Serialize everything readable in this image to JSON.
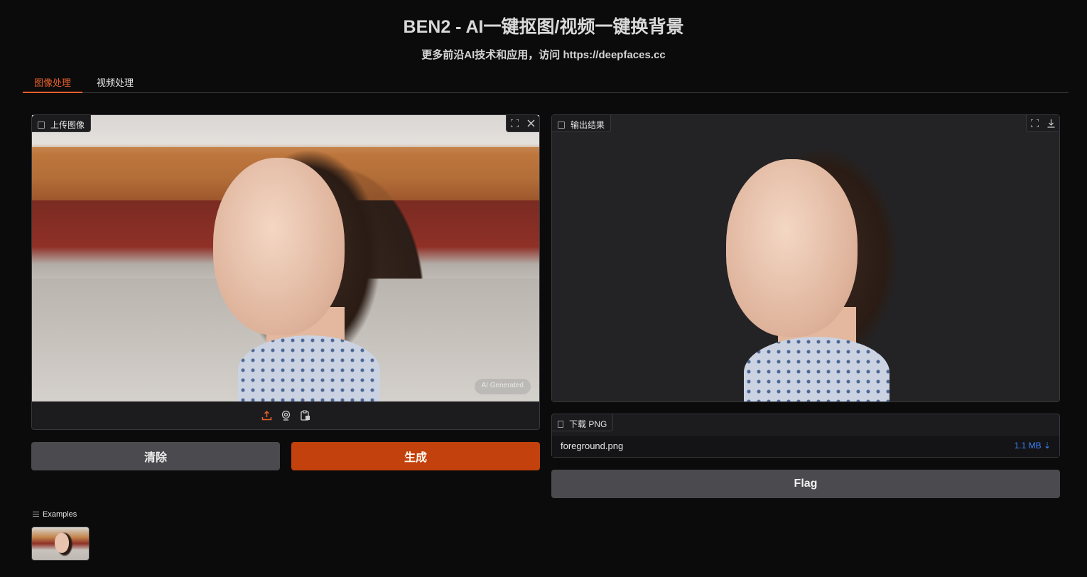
{
  "header": {
    "title": "BEN2 - AI一键抠图/视频一键换背景",
    "subtitle": "更多前沿AI技术和应用，访问 https://deepfaces.cc"
  },
  "tabs": [
    {
      "label": "图像处理",
      "active": true
    },
    {
      "label": "视频处理",
      "active": false
    }
  ],
  "input_panel": {
    "label": "上传图像",
    "icon": "image-icon",
    "watermark": "AI Generated",
    "source_icons": [
      "upload-icon",
      "webcam-icon",
      "clipboard-icon"
    ]
  },
  "output_panel": {
    "label": "输出结果",
    "icon": "image-icon"
  },
  "buttons": {
    "clear": "清除",
    "generate": "生成",
    "flag": "Flag"
  },
  "download": {
    "label": "下载 PNG",
    "file_name": "foreground.png",
    "file_size": "1.1 MB ⇣"
  },
  "examples": {
    "label": "Examples"
  },
  "colors": {
    "accent": "#c2410c",
    "tab_active": "#e8602c",
    "link": "#3b82f6",
    "background": "#0b0b0c"
  }
}
